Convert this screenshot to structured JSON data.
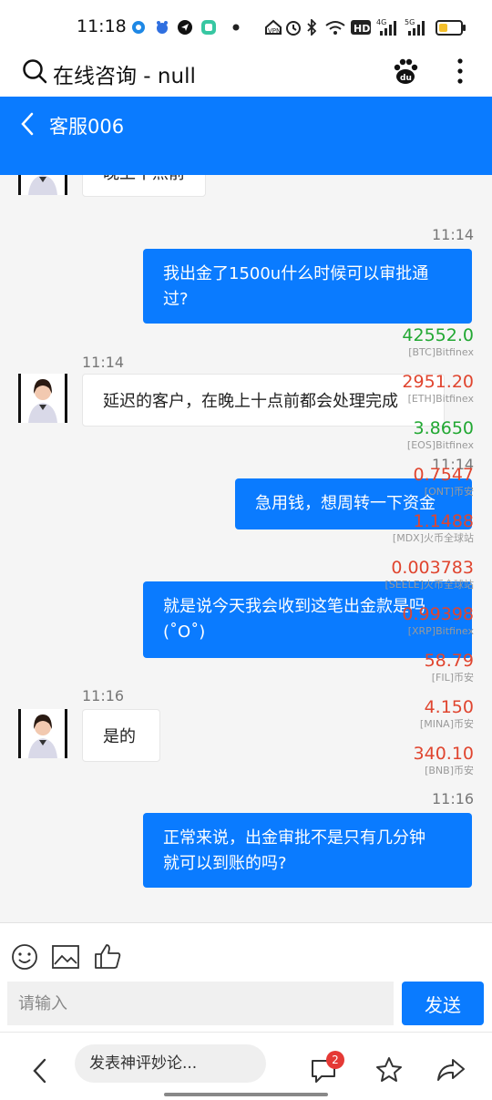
{
  "status_bar": {
    "time": "11:18",
    "net1": "4G",
    "net2": "5G"
  },
  "browser_bar": {
    "title": "在线咨询 - null"
  },
  "chat_header": {
    "title": "客服006"
  },
  "messages": {
    "partial_in": "晚上十点前",
    "ts1": "11:14",
    "out1_line1": "我出金了1500u什么时候可以审批通",
    "out1_line2": "过?",
    "ts2": "11:14",
    "in1": "延迟的客户，在晚上十点前都会处理完成",
    "ts3": "11:14",
    "out2": "急用钱，想周转一下资金",
    "out3_line1": "就是说今天我会收到这笔出金款是吗",
    "out3_line2": "(˚O˚)",
    "ts4": "11:16",
    "in2": "是的",
    "ts5": "11:16",
    "out4_line1": "正常来说，出金审批不是只有几分钟",
    "out4_line2": "就可以到账的吗?"
  },
  "tickers": [
    {
      "value": "42552.0",
      "name": "[BTC]Bitfinex",
      "color": "#22a833"
    },
    {
      "value": "2951.20",
      "name": "[ETH]Bitfinex",
      "color": "#e0452f"
    },
    {
      "value": "3.8650",
      "name": "[EOS]Bitfinex",
      "color": "#22a833"
    },
    {
      "value": "0.7547",
      "name": "[ONT]币安",
      "color": "#e0452f"
    },
    {
      "value": "1.1488",
      "name": "[MDX]火币全球站",
      "color": "#e0452f"
    },
    {
      "value": "0.003783",
      "name": "[SEELE]火币全球站",
      "color": "#e0452f"
    },
    {
      "value": "0.99398",
      "name": "[XRP]Bitfinex",
      "color": "#e0452f"
    },
    {
      "value": "58.79",
      "name": "[FIL]币安",
      "color": "#e0452f"
    },
    {
      "value": "4.150",
      "name": "[MINA]币安",
      "color": "#e0452f"
    },
    {
      "value": "340.10",
      "name": "[BNB]币安",
      "color": "#e0452f"
    }
  ],
  "input": {
    "placeholder": "请输入"
  },
  "send_button": {
    "label": "发送"
  },
  "bottom_nav": {
    "comment_placeholder": "发表神评妙论...",
    "badge_count": "2"
  },
  "colors": {
    "accent": "#0a7bff",
    "up": "#22a833",
    "down": "#e0452f"
  }
}
